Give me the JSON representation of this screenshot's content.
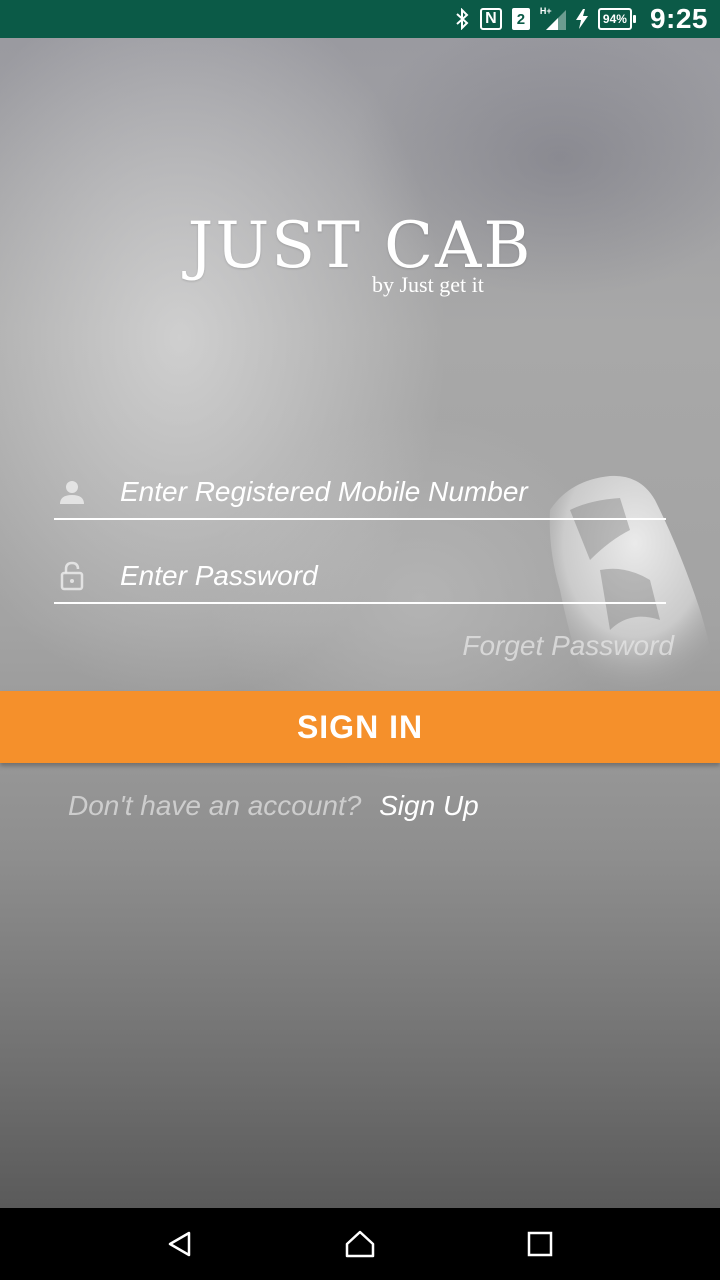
{
  "status_bar": {
    "time": "9:25",
    "battery_percent": "94%",
    "sim_slot": "2",
    "nfc_label": "N",
    "network_type": "H+",
    "icons": [
      "bluetooth-icon",
      "nfc-icon",
      "sim-icon",
      "signal-icon",
      "charging-icon",
      "battery-icon"
    ]
  },
  "logo": {
    "title": "JUST CAB",
    "tagline": "by Just get it"
  },
  "login_form": {
    "mobile_placeholder": "Enter Registered Mobile Number",
    "password_placeholder": "Enter Password",
    "forgot_password": "Forget Password",
    "sign_in_label": "SIGN IN",
    "signup_prompt": "Don't have an account?",
    "signup_link": "Sign Up"
  },
  "nav_bar": {
    "buttons": [
      "back-icon",
      "home-icon",
      "recents-icon"
    ]
  },
  "colors": {
    "status_bar": "#0b5a47",
    "accent": "#f5902b",
    "nav_bar": "#000000"
  }
}
